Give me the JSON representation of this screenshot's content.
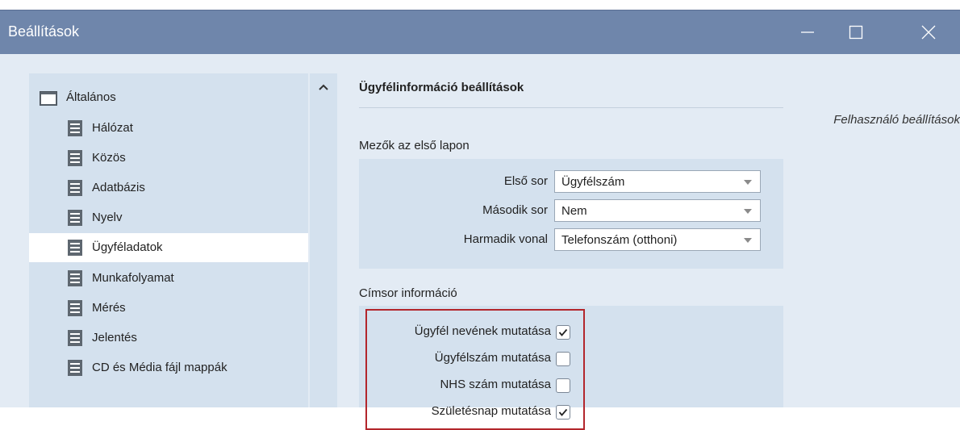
{
  "window": {
    "title": "Beállítások",
    "controls": {
      "minimize": "minimize-icon",
      "maximize": "maximize-icon",
      "close": "close-icon"
    }
  },
  "sidebar": {
    "root": {
      "label": "Általános",
      "icon": "folder-icon"
    },
    "items": [
      {
        "label": "Hálózat",
        "icon": "document-icon"
      },
      {
        "label": "Közös",
        "icon": "document-icon"
      },
      {
        "label": "Adatbázis",
        "icon": "document-icon"
      },
      {
        "label": "Nyelv",
        "icon": "document-icon"
      },
      {
        "label": "Ügyféladatok",
        "icon": "document-icon",
        "selected": true
      },
      {
        "label": "Munkafolyamat",
        "icon": "document-icon"
      },
      {
        "label": "Mérés",
        "icon": "document-icon"
      },
      {
        "label": "Jelentés",
        "icon": "document-icon"
      },
      {
        "label": "CD és Média fájl mappák",
        "icon": "document-icon"
      }
    ],
    "collapse_icon": "chevron-up-icon"
  },
  "main": {
    "title": "Ügyfélinformáció beállítások",
    "user_settings": "Felhasználó beállítások",
    "fields_group": {
      "label": "Mezők az első lapon",
      "rows": [
        {
          "label": "Első sor",
          "value": "Ügyfélszám"
        },
        {
          "label": "Második sor",
          "value": "Nem"
        },
        {
          "label": "Harmadik vonal",
          "value": "Telefonszám (otthoni)"
        }
      ]
    },
    "header_group": {
      "label": "Címsor információ",
      "checkboxes": [
        {
          "label": "Ügyfél nevének mutatása",
          "checked": true
        },
        {
          "label": "Ügyfélszám mutatása",
          "checked": false
        },
        {
          "label": "NHS szám mutatása",
          "checked": false
        },
        {
          "label": "Születésnap mutatása",
          "checked": true
        }
      ]
    }
  },
  "colors": {
    "titlebar": "#6f86ab",
    "window_bg": "#e3ebf4",
    "panel_bg": "#d4e1ee",
    "selected_bg": "#ffffff",
    "highlight_border": "#b3262c"
  }
}
